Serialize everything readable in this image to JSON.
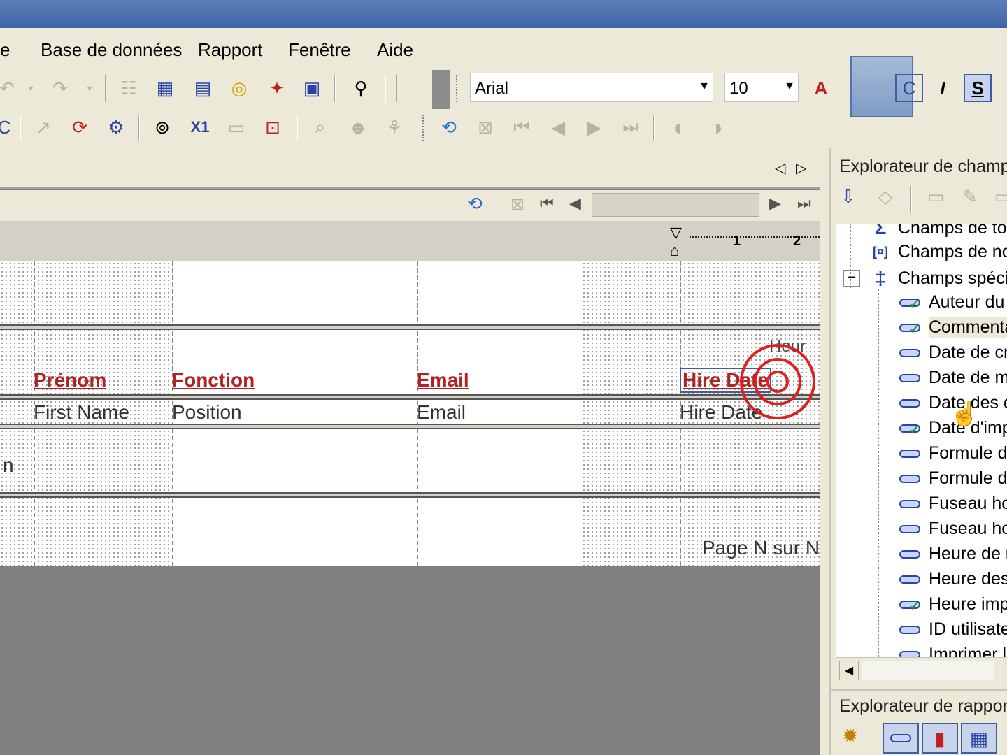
{
  "menubar": {
    "items": [
      {
        "id": "partial",
        "label": "e"
      },
      {
        "id": "database",
        "label": "Base de données"
      },
      {
        "id": "report",
        "label": "Rapport"
      },
      {
        "id": "window",
        "label": "Fenêtre"
      },
      {
        "id": "help",
        "label": "Aide"
      }
    ]
  },
  "formatting": {
    "font": "Arial",
    "size": "10",
    "font_color_glyph": "A",
    "italic": "I",
    "strike": "S"
  },
  "design": {
    "headers": {
      "prenom": "Prénom",
      "fonction": "Fonction",
      "email": "Email",
      "hire_date": "Hire Date",
      "heure_partial": "Heur"
    },
    "fields": {
      "first_name": "First Name",
      "position": "Position",
      "email": "Email",
      "hire_date": "Hire Date"
    },
    "left_partial": "n",
    "page_n": "Page N sur N",
    "ruler": {
      "marks": [
        "1",
        "2"
      ]
    }
  },
  "field_explorer": {
    "title": "Explorateur de champs",
    "groups": [
      {
        "label": "Champs de total",
        "icon": "Σ"
      },
      {
        "label": "Champs de nom",
        "icon": "[¤]"
      },
      {
        "label": "Champs spéciaux",
        "icon": "‡"
      }
    ],
    "items": [
      {
        "label": "Auteur du rapport",
        "check": true
      },
      {
        "label": "Commentaires",
        "check": true
      },
      {
        "label": "Date de création",
        "check": false
      },
      {
        "label": "Date de modification",
        "check": false
      },
      {
        "label": "Date des données",
        "check": false
      },
      {
        "label": "Date d'impression",
        "check": true
      },
      {
        "label": "Formule de groupe",
        "check": false
      },
      {
        "label": "Formule d'enregistrement",
        "check": false
      },
      {
        "label": "Fuseau horaire",
        "check": false
      },
      {
        "label": "Fuseau horaire des données",
        "check": false
      },
      {
        "label": "Heure de modification",
        "check": false
      },
      {
        "label": "Heure des données",
        "check": false
      },
      {
        "label": "Heure impression",
        "check": true
      },
      {
        "label": "ID utilisateur",
        "check": false
      },
      {
        "label": "Imprimer le titre",
        "check": false
      }
    ]
  },
  "report_explorer": {
    "title": "Explorateur de rapports"
  },
  "colors": {
    "header_red": "#b22222",
    "accent_blue": "#2a43a8",
    "target_red": "#e02020"
  }
}
